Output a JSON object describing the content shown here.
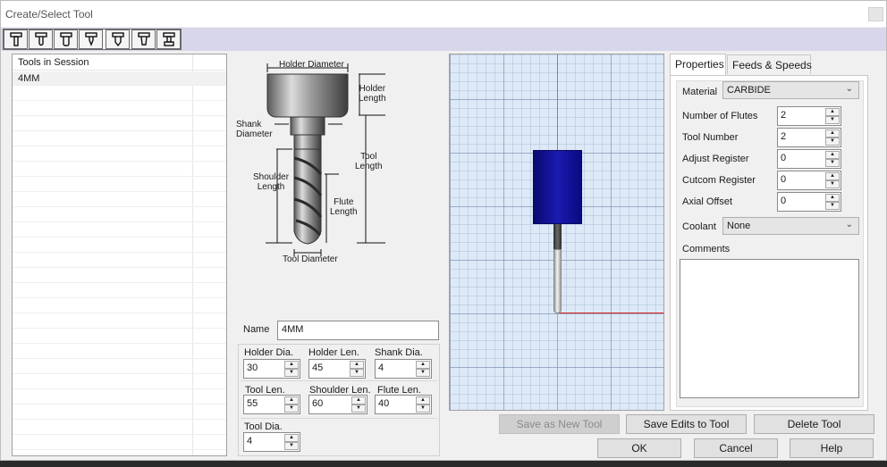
{
  "window": {
    "title": "Create/Select Tool"
  },
  "toolbar": {
    "icons": [
      "endmill-icon",
      "endmill-icon",
      "bullnose-icon",
      "chamfer-icon",
      "engraver-icon",
      "taper-icon",
      "tslot-icon"
    ]
  },
  "tool_list": {
    "header": "Tools in Session",
    "items": [
      "4MM"
    ]
  },
  "diagram": {
    "holder_diameter": "Holder Diameter",
    "holder_length": "Holder\nLength",
    "shank_diameter": "Shank\nDiameter",
    "tool_length": "Tool\nLength",
    "shoulder_length": "Shoulder\nLength",
    "flute_length": "Flute\nLength",
    "tool_diameter": "Tool Diameter"
  },
  "name": {
    "label": "Name",
    "value": "4MM"
  },
  "params": {
    "holder_dia": {
      "label": "Holder Dia.",
      "value": "30"
    },
    "holder_len": {
      "label": "Holder Len.",
      "value": "45"
    },
    "shank_dia": {
      "label": "Shank Dia.",
      "value": "4"
    },
    "tool_len": {
      "label": "Tool Len.",
      "value": "55"
    },
    "shoulder_len": {
      "label": "Shoulder Len.",
      "value": "60"
    },
    "flute_len": {
      "label": "Flute Len.",
      "value": "40"
    },
    "tool_dia": {
      "label": "Tool Dia.",
      "value": "4"
    }
  },
  "tabs": {
    "properties": "Properties",
    "feeds": "Feeds & Speeds"
  },
  "properties": {
    "material": {
      "label": "Material",
      "value": "CARBIDE"
    },
    "flutes": {
      "label": "Number of Flutes",
      "value": "2"
    },
    "tool_number": {
      "label": "Tool Number",
      "value": "2"
    },
    "adjust_register": {
      "label": "Adjust Register",
      "value": "0"
    },
    "cutcom_register": {
      "label": "Cutcom Register",
      "value": "0"
    },
    "axial_offset": {
      "label": "Axial Offset",
      "value": "0"
    },
    "coolant": {
      "label": "Coolant",
      "value": "None"
    },
    "comments_label": "Comments",
    "comments_value": ""
  },
  "buttons": {
    "save_new": "Save as New Tool",
    "save_edits": "Save Edits to Tool",
    "delete": "Delete Tool",
    "ok": "OK",
    "cancel": "Cancel",
    "help": "Help"
  },
  "colors": {
    "holder": "#0c0c9a",
    "axis_y": "#22cc33",
    "axis_x": "#dd2222",
    "grid_bg": "#dde9f7"
  }
}
